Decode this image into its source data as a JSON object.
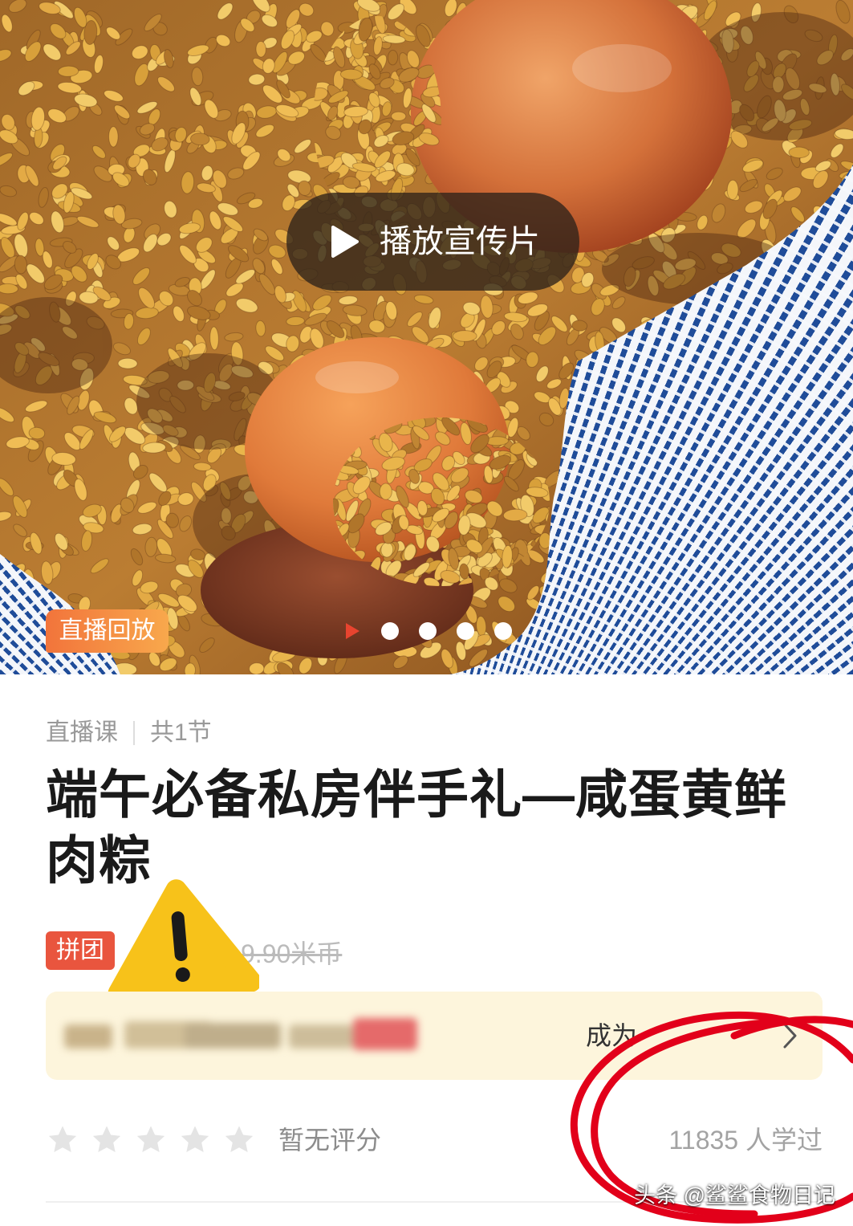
{
  "hero": {
    "play_button": {
      "label": "播放宣传片",
      "icon": "play-icon"
    },
    "badge": "直播回放",
    "carousel": {
      "total": 5,
      "active_index": 0,
      "active_icon": "play-triangle-icon"
    }
  },
  "course": {
    "type_label": "直播课",
    "lesson_count": "共1节",
    "title": "端午必备私房伴手礼—咸蛋黄鲜肉粽"
  },
  "pricing": {
    "tag": "拼团",
    "original_price": "9.90米币",
    "original_price_struck": true
  },
  "group_banner": {
    "text_obscured": true,
    "action_text": "成为",
    "icon": "chevron-right-icon"
  },
  "rating": {
    "stars_total": 5,
    "stars_filled": 0,
    "icon": "star-icon",
    "text": "暂无评分"
  },
  "learners": "11835 人学过",
  "watermark": "头条 @鲨鲨食物日记",
  "overlays": {
    "warning": "warning-icon",
    "annotation": "red-circle-annotation-icon"
  },
  "colors": {
    "accent_red": "#e9553e",
    "badge_orange_start": "#f2743b",
    "badge_orange_end": "#f8a84c",
    "banner_bg": "#fdf5dc",
    "annotation_red": "#e2001a",
    "warning_yellow": "#f7c21a",
    "star_empty": "#e4e4e4",
    "star_filled": "#f5a623",
    "muted_text": "#999999",
    "carousel_active": "#e8442f"
  }
}
